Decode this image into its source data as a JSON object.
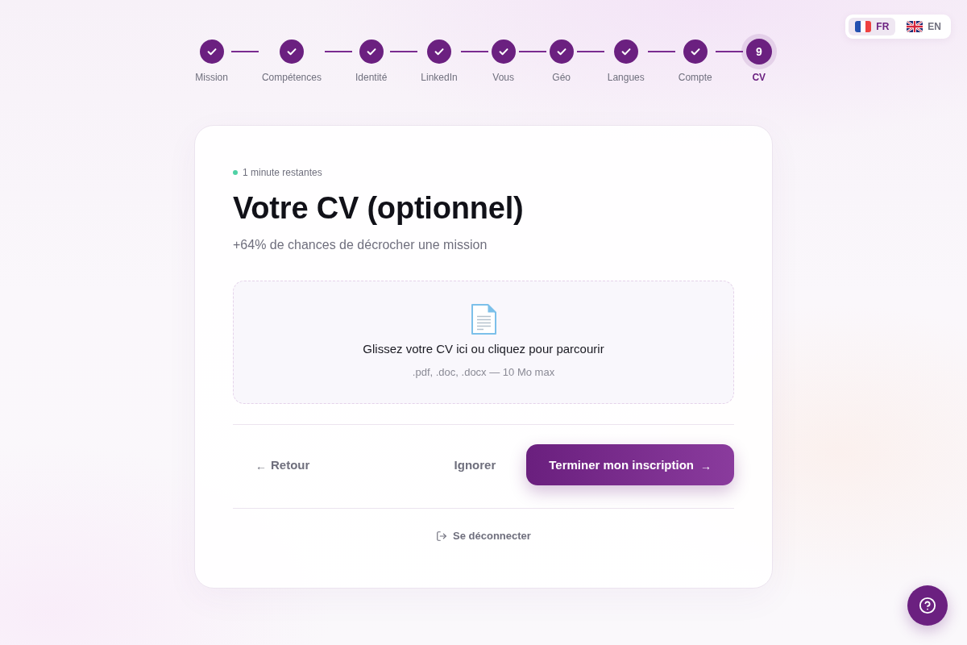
{
  "language_switcher": [
    {
      "code": "FR",
      "selected": true
    },
    {
      "code": "EN",
      "selected": false
    }
  ],
  "stepper": {
    "steps": [
      {
        "label": "Mission",
        "completed": true,
        "current": false
      },
      {
        "label": "Compétences",
        "completed": true,
        "current": false
      },
      {
        "label": "Identité",
        "completed": true,
        "current": false
      },
      {
        "label": "LinkedIn",
        "completed": true,
        "current": false
      },
      {
        "label": "Vous",
        "completed": true,
        "current": false
      },
      {
        "label": "Géo",
        "completed": true,
        "current": false
      },
      {
        "label": "Langues",
        "completed": true,
        "current": false
      },
      {
        "label": "Compte",
        "completed": true,
        "current": false
      },
      {
        "label": "CV",
        "completed": false,
        "current": true,
        "number": "9"
      }
    ]
  },
  "card": {
    "timer": "1 minute restantes",
    "title": "Votre CV (optionnel)",
    "subtitle": "+64% de chances de décrocher une mission",
    "dropzone": {
      "text": "Glissez votre CV ici ou cliquez pour parcourir",
      "hint": ".pdf, .doc, .docx — 10 Mo max"
    },
    "back_button": {
      "arrow": "←",
      "label": "Retour"
    },
    "skip_button": {
      "label": "Ignorer"
    },
    "submit_button": {
      "label": "Terminer mon inscription",
      "arrow": "→"
    },
    "logout_link": {
      "label": "Se déconnecter"
    }
  }
}
